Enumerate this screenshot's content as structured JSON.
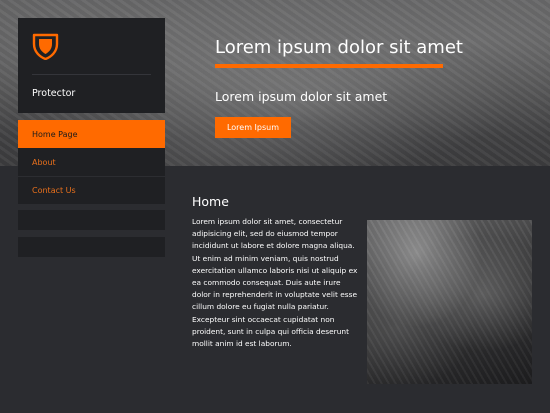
{
  "hero": {
    "title": "Lorem ipsum dolor sit amet",
    "subtitle": "Lorem ipsum dolor sit amet",
    "button_label": "Lorem Ipsum"
  },
  "sidebar": {
    "brand_icon": "shield-icon",
    "brand_name": "Protector",
    "nav": [
      {
        "label": "Home Page",
        "active": true
      },
      {
        "label": "About",
        "active": false
      },
      {
        "label": "Contact Us",
        "active": false
      }
    ]
  },
  "content": {
    "title": "Home",
    "body": "Lorem ipsum dolor sit amet, consectetur adipisicing elit, sed do eiusmod tempor incididunt ut labore et dolore magna aliqua. Ut enim ad minim veniam, quis nostrud exercitation ullamco laboris nisi ut aliquip ex ea commodo consequat. Duis aute irure dolor in reprehenderit in voluptate velit esse cillum dolore eu fugiat nulla pariatur. Excepteur sint occaecat cupidatat non proident, sunt in culpa qui officia deserunt mollit anim id est laborum."
  },
  "colors": {
    "accent": "#ff6a00",
    "panel": "#1f2023",
    "background": "#2b2c30"
  }
}
